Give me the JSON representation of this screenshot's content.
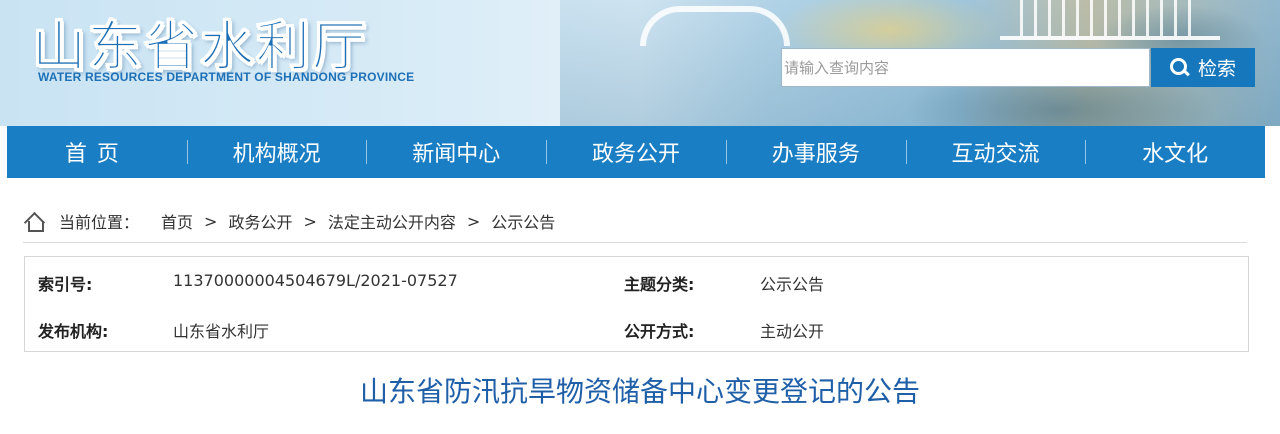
{
  "header": {
    "logo_cn": "山东省水利厅",
    "logo_en": "WATER RESOURCES DEPARTMENT OF SHANDONG PROVINCE",
    "search_placeholder": "请输入查询内容",
    "search_button": "检索"
  },
  "nav": {
    "items": [
      "首页",
      "机构概况",
      "新闻中心",
      "政务公开",
      "办事服务",
      "互动交流",
      "水文化"
    ]
  },
  "breadcrumb": {
    "label": "当前位置：",
    "items": [
      "首页",
      "政务公开",
      "法定主动公开内容",
      "公示公告"
    ],
    "separator": ">"
  },
  "info": {
    "index_label": "索引号:",
    "index_value": "11370000004504679L/2021-07527",
    "topic_label": "主题分类:",
    "topic_value": "公示公告",
    "publisher_label": "发布机构:",
    "publisher_value": "山东省水利厅",
    "method_label": "公开方式:",
    "method_value": "主动公开"
  },
  "article": {
    "title": "山东省防汛抗旱物资储备中心变更登记的公告"
  },
  "colors": {
    "nav_bg": "#1a7ec5",
    "title": "#1f5fa8",
    "search_button": "#1677bd"
  }
}
